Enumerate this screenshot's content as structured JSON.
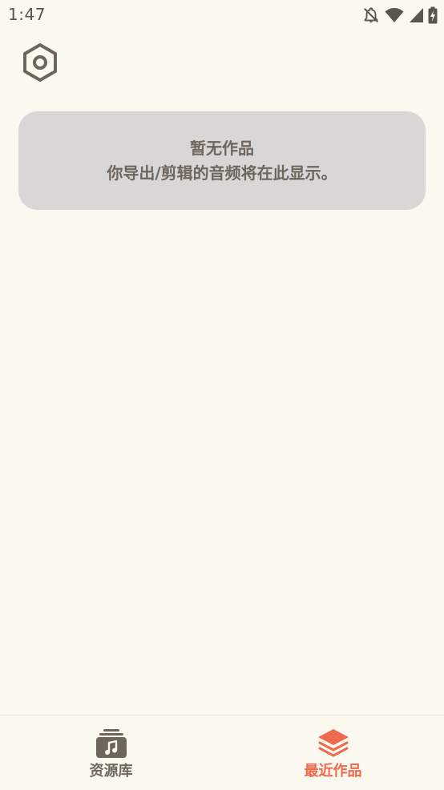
{
  "status_bar": {
    "time": "1:47",
    "icons": [
      "bell-off-icon",
      "wifi-icon",
      "signal-icon",
      "battery-charging-icon"
    ]
  },
  "toolbar": {
    "settings_icon": "hexagon-settings-icon"
  },
  "empty_state": {
    "title": "暂无作品",
    "subtitle": "你导出/剪辑的音频将在此显示。"
  },
  "bottom_nav": {
    "items": [
      {
        "label": "资源库",
        "icon": "music-library-icon",
        "active": false
      },
      {
        "label": "最近作品",
        "icon": "layers-icon",
        "active": true
      }
    ]
  },
  "colors": {
    "background": "#FBF8F0",
    "card": "#D9D7D5",
    "text": "#6E655D",
    "accent": "#EE6A4D"
  }
}
